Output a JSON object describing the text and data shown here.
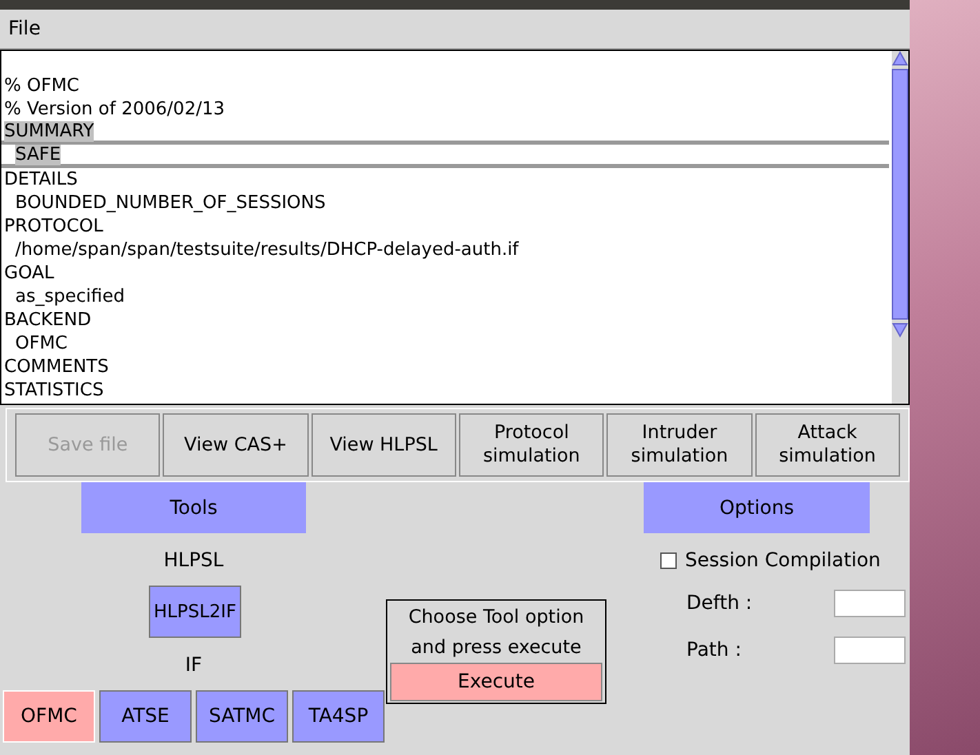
{
  "menu": [
    "File"
  ],
  "output": {
    "lines": [
      {
        "text": "% OFMC",
        "selected": false
      },
      {
        "text": "% Version of 2006/02/13",
        "selected": false
      },
      {
        "text": "SUMMARY",
        "selected": true
      },
      {
        "text": "  SAFE",
        "selected": true
      },
      {
        "text": "DETAILS",
        "selected": false
      },
      {
        "text": "  BOUNDED_NUMBER_OF_SESSIONS",
        "selected": false
      },
      {
        "text": "PROTOCOL",
        "selected": false
      },
      {
        "text": "  /home/span/span/testsuite/results/DHCP-delayed-auth.if",
        "selected": false
      },
      {
        "text": "GOAL",
        "selected": false
      },
      {
        "text": "  as_specified",
        "selected": false
      },
      {
        "text": "BACKEND",
        "selected": false
      },
      {
        "text": "  OFMC",
        "selected": false
      },
      {
        "text": "COMMENTS",
        "selected": false
      },
      {
        "text": "STATISTICS",
        "selected": false
      }
    ]
  },
  "actions": [
    {
      "label": "Save file",
      "disabled": true
    },
    {
      "label": "View CAS+",
      "disabled": false
    },
    {
      "label": "View HLPSL",
      "disabled": false
    },
    {
      "label": "Protocol simulation",
      "disabled": false
    },
    {
      "label": "Intruder simulation",
      "disabled": false
    },
    {
      "label": "Attack simulation",
      "disabled": false
    }
  ],
  "tools": {
    "header": "Tools",
    "input_label": "HLPSL",
    "translator": "HLPSL2IF",
    "output_label": "IF",
    "backends": [
      {
        "label": "OFMC",
        "selected": true
      },
      {
        "label": "ATSE",
        "selected": false
      },
      {
        "label": "SATMC",
        "selected": false
      },
      {
        "label": "TA4SP",
        "selected": false
      }
    ]
  },
  "execute": {
    "hint": "Choose Tool option and press execute",
    "button": "Execute"
  },
  "options": {
    "header": "Options",
    "session_compilation": {
      "label": "Session Compilation",
      "checked": false
    },
    "fields": [
      {
        "label": "Defth :"
      },
      {
        "label": "Path :"
      }
    ]
  }
}
